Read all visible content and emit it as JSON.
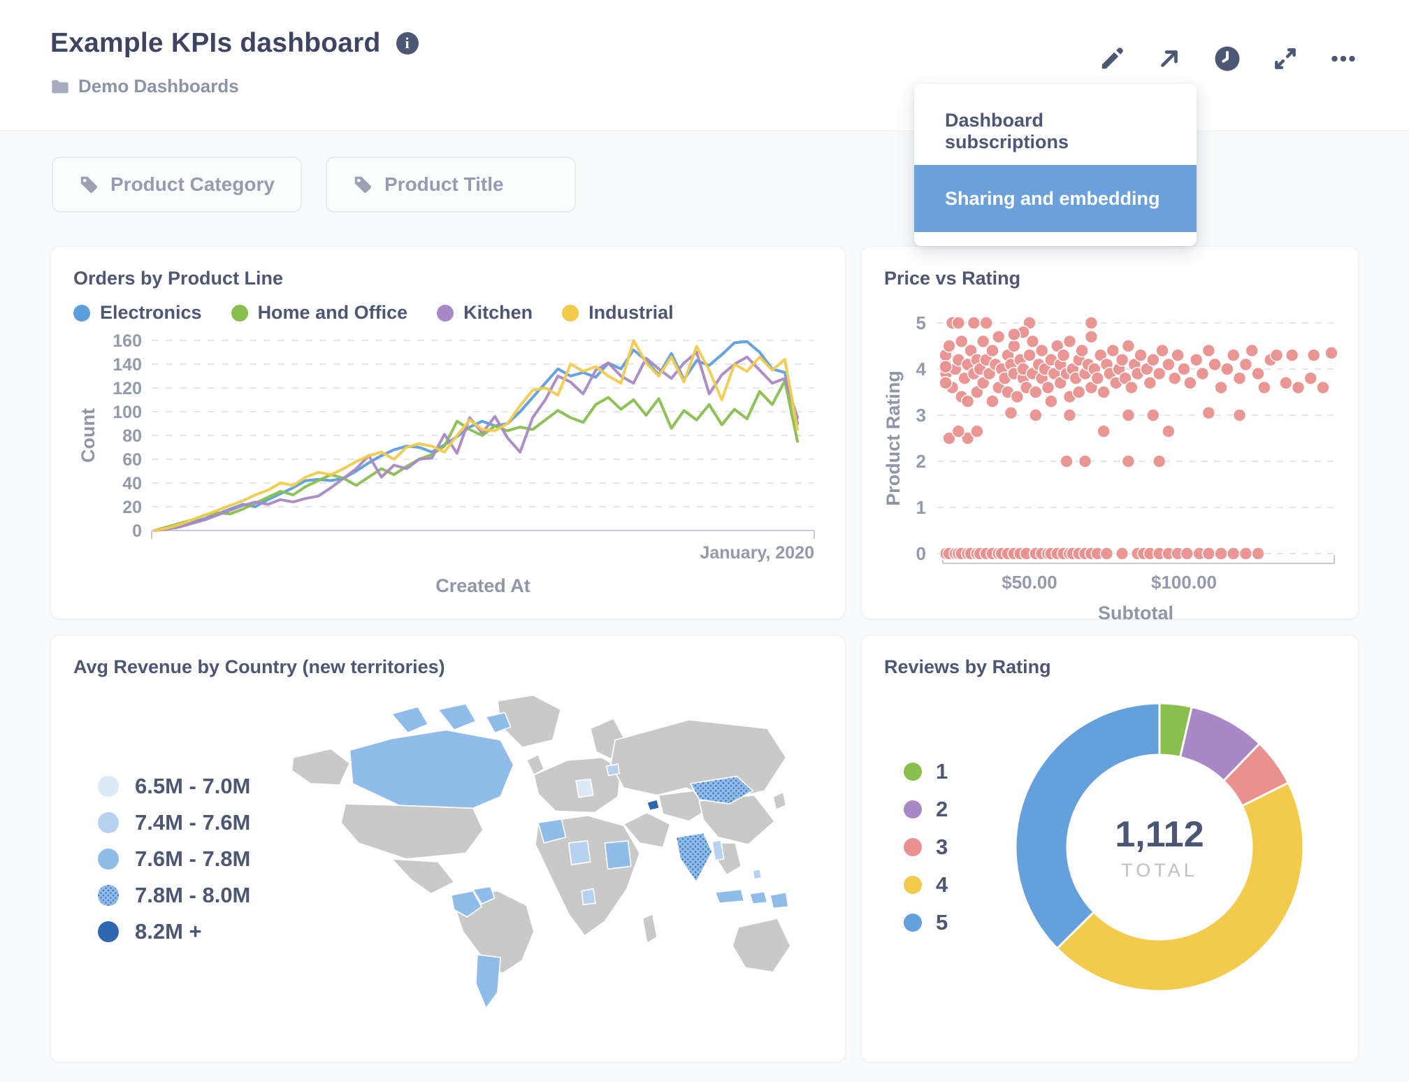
{
  "header": {
    "title": "Example KPIs dashboard",
    "breadcrumb": "Demo Dashboards",
    "action_icons": [
      "edit-icon",
      "share-icon",
      "history-clock-icon",
      "fullscreen-icon",
      "ellipsis-icon"
    ],
    "menu": {
      "items": [
        {
          "label": "Dashboard subscriptions",
          "active": false
        },
        {
          "label": "Sharing and embedding",
          "active": true
        }
      ],
      "active_color": "#6BA0DB"
    }
  },
  "filters": [
    {
      "label": "Product Category",
      "icon": "tag-icon"
    },
    {
      "label": "Product Title",
      "icon": "tag-icon"
    }
  ],
  "colors": {
    "accent_blue": "#6BA0DB",
    "text_dark": "#4C5773",
    "text_gray": "#949AAB",
    "axis_gray": "#8F96A8"
  },
  "chart_data": [
    {
      "id": "orders_by_product_line",
      "type": "line",
      "title": "Orders by Product Line",
      "xlabel": "Created At",
      "ylabel": "Count",
      "ylim": [
        0,
        160
      ],
      "y_ticks": [
        0,
        20,
        40,
        60,
        80,
        100,
        120,
        140,
        160
      ],
      "x_axis_end_label": "January, 2020",
      "grid": "dashed-horizontal",
      "legend_position": "top",
      "series": [
        {
          "name": "Electronics",
          "color": "#5C9EDE",
          "values": [
            0,
            2,
            4,
            7,
            10,
            14,
            18,
            22,
            20,
            26,
            31,
            36,
            42,
            43,
            42,
            44,
            50,
            57,
            63,
            68,
            71,
            70,
            66,
            72,
            79,
            87,
            92,
            88,
            90,
            100,
            112,
            124,
            136,
            130,
            133,
            129,
            141,
            136,
            152,
            143,
            131,
            149,
            127,
            143,
            139,
            148,
            158,
            159,
            150,
            136,
            133,
            90
          ]
        },
        {
          "name": "Home and Office",
          "color": "#88BF4D",
          "values": [
            0,
            3,
            6,
            9,
            13,
            15,
            14,
            18,
            23,
            28,
            33,
            30,
            37,
            42,
            47,
            44,
            38,
            45,
            52,
            47,
            54,
            60,
            64,
            71,
            92,
            85,
            80,
            88,
            84,
            87,
            85,
            93,
            101,
            95,
            91,
            106,
            112,
            102,
            110,
            97,
            111,
            86,
            101,
            93,
            106,
            89,
            102,
            94,
            117,
            106,
            126,
            75
          ]
        },
        {
          "name": "Kitchen",
          "color": "#A989C5",
          "values": [
            0,
            1,
            3,
            6,
            9,
            13,
            17,
            21,
            24,
            22,
            26,
            24,
            27,
            29,
            36,
            44,
            52,
            63,
            45,
            55,
            52,
            60,
            61,
            81,
            65,
            95,
            82,
            96,
            78,
            66,
            95,
            110,
            130,
            125,
            115,
            135,
            141,
            130,
            124,
            145,
            136,
            128,
            141,
            150,
            115,
            131,
            140,
            146,
            135,
            124,
            128,
            95
          ]
        },
        {
          "name": "Industrial",
          "color": "#F2CB4D",
          "values": [
            0,
            2,
            5,
            9,
            13,
            17,
            21,
            25,
            30,
            34,
            40,
            38,
            45,
            49,
            47,
            52,
            58,
            63,
            66,
            60,
            70,
            73,
            71,
            66,
            80,
            93,
            85,
            84,
            90,
            105,
            118,
            120,
            114,
            140,
            134,
            138,
            130,
            124,
            160,
            141,
            130,
            146,
            125,
            155,
            135,
            110,
            140,
            134,
            146,
            135,
            144,
            85
          ]
        }
      ]
    },
    {
      "id": "price_vs_rating",
      "type": "scatter",
      "title": "Price vs Rating",
      "xlabel": "Subtotal",
      "ylabel": "Product Rating",
      "ylim": [
        0,
        5
      ],
      "y_ticks": [
        0,
        1,
        2,
        3,
        4,
        5
      ],
      "x_ticks": [
        {
          "label": "$50.00",
          "value": 50
        },
        {
          "label": "$100.00",
          "value": 100
        }
      ],
      "point_color": "#E8918F",
      "grid": "dashed-horizontal",
      "points": [
        [
          18,
          4.0
        ],
        [
          20,
          4.1
        ],
        [
          22,
          4.3
        ],
        [
          23,
          3.9
        ],
        [
          24,
          4.5
        ],
        [
          25,
          3.6
        ],
        [
          26,
          4.0
        ],
        [
          27,
          4.2
        ],
        [
          28,
          3.4
        ],
        [
          28,
          4.6
        ],
        [
          29,
          3.8
        ],
        [
          30,
          4.1
        ],
        [
          30,
          3.3
        ],
        [
          31,
          4.4
        ],
        [
          32,
          3.9
        ],
        [
          33,
          4.2
        ],
        [
          33,
          3.5
        ],
        [
          34,
          4.0
        ],
        [
          35,
          4.6
        ],
        [
          35,
          3.7
        ],
        [
          36,
          4.2
        ],
        [
          37,
          3.9
        ],
        [
          38,
          4.4
        ],
        [
          38,
          3.3
        ],
        [
          39,
          4.1
        ],
        [
          40,
          3.6
        ],
        [
          40,
          4.7
        ],
        [
          41,
          4.0
        ],
        [
          42,
          3.8
        ],
        [
          43,
          4.3
        ],
        [
          43,
          3.5
        ],
        [
          44,
          4.1
        ],
        [
          45,
          3.9
        ],
        [
          45,
          4.5
        ],
        [
          46,
          3.4
        ],
        [
          47,
          4.2
        ],
        [
          48,
          3.8
        ],
        [
          48,
          4.0
        ],
        [
          49,
          3.6
        ],
        [
          50,
          4.3
        ],
        [
          51,
          3.9
        ],
        [
          51,
          4.6
        ],
        [
          52,
          3.5
        ],
        [
          53,
          4.1
        ],
        [
          54,
          3.8
        ],
        [
          54,
          4.4
        ],
        [
          55,
          4.0
        ],
        [
          56,
          3.6
        ],
        [
          57,
          4.2
        ],
        [
          57,
          3.3
        ],
        [
          58,
          3.9
        ],
        [
          59,
          4.5
        ],
        [
          60,
          4.1
        ],
        [
          60,
          3.7
        ],
        [
          61,
          4.3
        ],
        [
          62,
          3.9
        ],
        [
          63,
          4.6
        ],
        [
          63,
          3.4
        ],
        [
          64,
          4.0
        ],
        [
          65,
          3.8
        ],
        [
          66,
          4.2
        ],
        [
          66,
          3.5
        ],
        [
          67,
          4.4
        ],
        [
          68,
          3.9
        ],
        [
          69,
          4.1
        ],
        [
          70,
          3.6
        ],
        [
          70,
          4.7
        ],
        [
          71,
          4.0
        ],
        [
          72,
          3.8
        ],
        [
          73,
          4.3
        ],
        [
          74,
          3.5
        ],
        [
          75,
          4.1
        ],
        [
          76,
          3.9
        ],
        [
          77,
          4.4
        ],
        [
          78,
          3.7
        ],
        [
          79,
          4.0
        ],
        [
          80,
          4.2
        ],
        [
          81,
          3.8
        ],
        [
          82,
          4.5
        ],
        [
          83,
          3.6
        ],
        [
          84,
          4.1
        ],
        [
          85,
          3.9
        ],
        [
          86,
          4.3
        ],
        [
          88,
          4.0
        ],
        [
          89,
          3.7
        ],
        [
          90,
          4.2
        ],
        [
          92,
          3.9
        ],
        [
          93,
          4.4
        ],
        [
          95,
          4.1
        ],
        [
          97,
          3.8
        ],
        [
          98,
          4.3
        ],
        [
          100,
          4.0
        ],
        [
          102,
          3.7
        ],
        [
          104,
          4.2
        ],
        [
          106,
          3.9
        ],
        [
          108,
          4.4
        ],
        [
          110,
          4.1
        ],
        [
          112,
          3.6
        ],
        [
          114,
          4.0
        ],
        [
          116,
          4.3
        ],
        [
          118,
          3.8
        ],
        [
          120,
          4.1
        ],
        [
          122,
          4.4
        ],
        [
          124,
          3.9
        ],
        [
          126,
          3.6
        ],
        [
          128,
          4.2
        ],
        [
          130,
          4.3
        ],
        [
          133,
          3.7
        ],
        [
          135,
          4.3
        ],
        [
          137,
          3.6
        ],
        [
          141,
          3.8
        ],
        [
          142,
          4.3
        ],
        [
          145,
          3.6
        ],
        [
          148,
          4.35
        ],
        [
          14,
          4.05
        ],
        [
          16,
          3.7
        ],
        [
          25,
          5
        ],
        [
          27,
          5
        ],
        [
          32,
          5
        ],
        [
          36,
          5
        ],
        [
          50,
          5
        ],
        [
          70,
          5
        ],
        [
          48,
          4.8
        ],
        [
          45,
          4.75
        ],
        [
          24,
          2.5
        ],
        [
          30,
          2.5
        ],
        [
          27,
          2.65
        ],
        [
          33,
          2.65
        ],
        [
          44,
          3.05
        ],
        [
          52,
          3.0
        ],
        [
          63,
          3.0
        ],
        [
          74,
          2.65
        ],
        [
          82,
          3.0
        ],
        [
          90,
          3.0
        ],
        [
          95,
          2.65
        ],
        [
          108,
          3.05
        ],
        [
          118,
          3.0
        ],
        [
          62,
          2
        ],
        [
          68,
          2
        ],
        [
          82,
          2
        ],
        [
          92,
          2
        ],
        [
          14,
          0
        ],
        [
          16,
          0
        ],
        [
          19,
          0
        ],
        [
          21,
          0
        ],
        [
          23,
          0
        ],
        [
          24,
          0
        ],
        [
          26,
          0
        ],
        [
          27,
          0
        ],
        [
          28,
          0
        ],
        [
          30,
          0
        ],
        [
          31,
          0
        ],
        [
          33,
          0
        ],
        [
          34,
          0
        ],
        [
          36,
          0
        ],
        [
          38,
          0
        ],
        [
          40,
          0
        ],
        [
          41,
          0
        ],
        [
          43,
          0
        ],
        [
          45,
          0
        ],
        [
          47,
          0
        ],
        [
          49,
          0
        ],
        [
          52,
          0
        ],
        [
          54,
          0
        ],
        [
          56,
          0
        ],
        [
          57,
          0
        ],
        [
          59,
          0
        ],
        [
          61,
          0
        ],
        [
          63,
          0
        ],
        [
          64,
          0
        ],
        [
          66,
          0
        ],
        [
          68,
          0
        ],
        [
          70,
          0
        ],
        [
          72,
          0
        ],
        [
          75,
          0
        ],
        [
          80,
          0
        ],
        [
          85,
          0
        ],
        [
          87,
          0
        ],
        [
          89,
          0
        ],
        [
          92,
          0
        ],
        [
          95,
          0
        ],
        [
          98,
          0
        ],
        [
          101,
          0
        ],
        [
          105,
          0
        ],
        [
          108,
          0
        ],
        [
          112,
          0
        ],
        [
          116,
          0
        ],
        [
          120,
          0
        ],
        [
          124,
          0
        ]
      ]
    },
    {
      "id": "avg_revenue_by_country",
      "type": "choropleth_map",
      "title": "Avg Revenue by Country (new territories)",
      "no_data_color": "#C9C9C9",
      "legend_bins": [
        {
          "label": "6.5M - 7.0M",
          "color": "#DCE9F7"
        },
        {
          "label": "7.4M - 7.6M",
          "color": "#B7D2F0"
        },
        {
          "label": "7.6M - 7.8M",
          "color": "#8FBCE8"
        },
        {
          "label": "7.8M - 8.0M",
          "color": "#8FBCE8",
          "pattern": "dots"
        },
        {
          "label": "8.2M +",
          "color": "#2E66B0"
        }
      ],
      "regions": {
        "canada": "7.6M - 7.8M",
        "germany": "6.5M - 7.0M",
        "latvia": "7.4M - 7.6M",
        "morocco": "7.6M - 7.8M",
        "niger": "7.4M - 7.6M",
        "sudan": "7.6M - 7.8M",
        "gabon": "7.4M - 7.6M",
        "colombia": "7.6M - 7.8M",
        "venezuela": "7.6M - 7.8M",
        "argentina": "7.6M - 7.8M",
        "azerbaijan": "8.2M +",
        "mongolia": "7.8M - 8.0M",
        "india": "7.8M - 8.0M",
        "myanmar": "7.4M - 7.6M",
        "philippines": "7.4M - 7.6M",
        "indonesia": "7.6M - 7.8M",
        "papua-new-guinea": "7.6M - 7.8M"
      }
    },
    {
      "id": "reviews_by_rating",
      "type": "pie",
      "title": "Reviews by Rating",
      "total_label": "1,112",
      "total_sublabel": "TOTAL",
      "legend_position": "left",
      "slices": [
        {
          "label": "1",
          "value": 40,
          "color": "#88BF4D"
        },
        {
          "label": "2",
          "value": 96,
          "color": "#A989C5"
        },
        {
          "label": "3",
          "value": 60,
          "color": "#E8918F"
        },
        {
          "label": "4",
          "value": 500,
          "color": "#F2CB4D"
        },
        {
          "label": "5",
          "value": 416,
          "color": "#64A1DC"
        }
      ]
    }
  ]
}
